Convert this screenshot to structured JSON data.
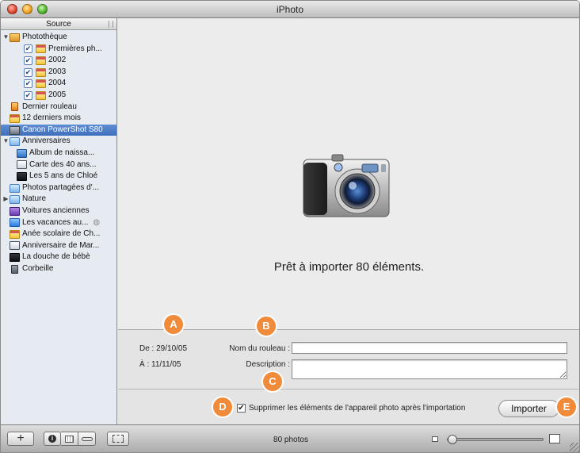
{
  "window": {
    "title": "iPhoto"
  },
  "sidebar": {
    "header": "Source",
    "items": [
      {
        "label": "Photothèque",
        "indent": 0,
        "disclosure": "▼",
        "icon": "library-icon"
      },
      {
        "label": "Premières ph...",
        "indent": 2,
        "checked": true,
        "icon": "calendar-icon"
      },
      {
        "label": "2002",
        "indent": 2,
        "checked": true,
        "icon": "calendar-icon"
      },
      {
        "label": "2003",
        "indent": 2,
        "checked": true,
        "icon": "calendar-icon"
      },
      {
        "label": "2004",
        "indent": 2,
        "checked": true,
        "icon": "calendar-icon"
      },
      {
        "label": "2005",
        "indent": 2,
        "checked": true,
        "icon": "calendar-icon"
      },
      {
        "label": "Dernier rouleau",
        "indent": 0,
        "icon": "film-roll-icon"
      },
      {
        "label": "12 derniers mois",
        "indent": 0,
        "icon": "calendar-icon"
      },
      {
        "label": "Canon PowerShot S80",
        "indent": 0,
        "icon": "camera-icon",
        "selected": true
      },
      {
        "label": "Anniversaires",
        "indent": 0,
        "disclosure": "▼",
        "icon": "folder-icon"
      },
      {
        "label": "Album de naissa...",
        "indent": 1,
        "icon": "album-icon"
      },
      {
        "label": "Carte des 40 ans...",
        "indent": 1,
        "icon": "book-icon"
      },
      {
        "label": "Les 5 ans de Chloé",
        "indent": 1,
        "icon": "slideshow-icon"
      },
      {
        "label": "Photos partagées d'...",
        "indent": 0,
        "icon": "folder-icon"
      },
      {
        "label": "Nature",
        "indent": 0,
        "disclosure": "▶",
        "icon": "folder-icon"
      },
      {
        "label": "Voitures anciennes",
        "indent": 0,
        "icon": "smart-album-icon"
      },
      {
        "label": "Les vacances au...",
        "indent": 0,
        "icon": "shared-album-icon",
        "shared": true
      },
      {
        "label": "Anée scolaire de Ch...",
        "indent": 0,
        "icon": "calendar-icon"
      },
      {
        "label": "Anniversaire de Mar...",
        "indent": 0,
        "icon": "book-icon"
      },
      {
        "label": "La douche de bébè",
        "indent": 0,
        "icon": "slideshow-icon"
      },
      {
        "label": "Corbeille",
        "indent": 0,
        "icon": "trash-icon"
      }
    ]
  },
  "viewer": {
    "icon": "camera-illustration",
    "ready_text": "Prêt à importer 80 éléments."
  },
  "import_panel": {
    "from_label": "De : 29/10/05",
    "to_label": "À : 11/11/05",
    "roll_name_label": "Nom du rouleau :",
    "roll_name_value": "",
    "description_label": "Description :",
    "description_value": "",
    "delete_checkbox_label": "Supprimer les éléments de l'appareil photo après l'importation",
    "delete_checked": true,
    "import_button": "Importer"
  },
  "callouts": [
    "A",
    "B",
    "C",
    "D",
    "E"
  ],
  "toolbar": {
    "add_button": "+",
    "photo_count": "80 photos"
  },
  "colors": {
    "selection": "#4a7cc8",
    "callout": "#ef8b3a"
  }
}
